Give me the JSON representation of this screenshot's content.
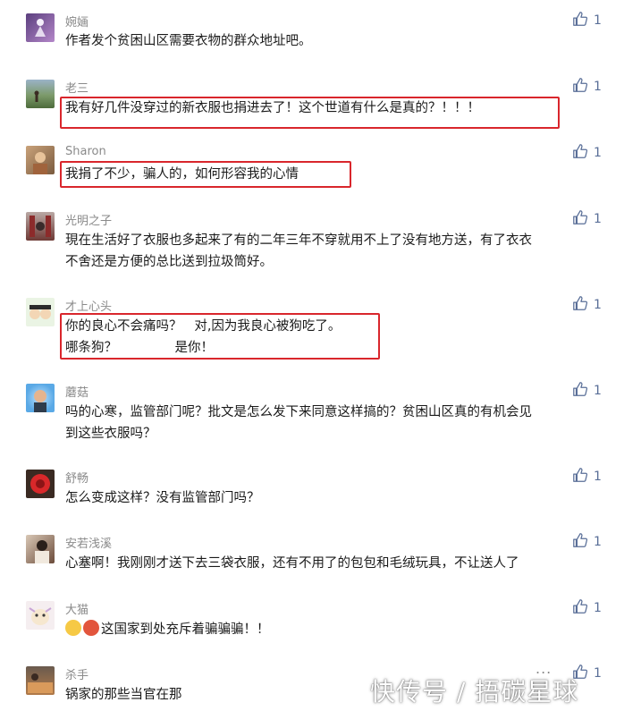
{
  "comments": [
    {
      "name": "婉婳",
      "lines": [
        "作者发个贫困山区需要衣物的群众地址吧。"
      ],
      "likes": "1"
    },
    {
      "name": "老三",
      "lines": [
        "我有好几件没穿过的新衣服也捐进去了！这个世道有什么是真的？！！！"
      ],
      "likes": "1"
    },
    {
      "name": "Sharon",
      "lines": [
        "我捐了不少，骗人的，如何形容我的心情"
      ],
      "likes": "1"
    },
    {
      "name": "光明之子",
      "lines": [
        "現在生活好了衣服也多起来了有的二年三年不穿就用不上了没有地方送，有了衣衣",
        "不舍还是方便的总比送到拉圾筒好。"
      ],
      "likes": "1"
    },
    {
      "name": "才上心头",
      "lines": [
        "你的良心不会痛吗？   对,因为我良心被狗吃了。",
        "哪条狗？              是你！"
      ],
      "likes": "1"
    },
    {
      "name": "蘑菇",
      "lines": [
        "吗的心寒，监管部门呢？批文是怎么发下来同意这样搞的？贫困山区真的有机会见",
        "到这些衣服吗？"
      ],
      "likes": "1"
    },
    {
      "name": "舒畅",
      "lines": [
        "怎么变成这样？没有监管部门吗？"
      ],
      "likes": "1"
    },
    {
      "name": "安若浅溪",
      "lines": [
        "心塞啊！我刚刚才送下去三袋衣服，还有不用了的包包和毛绒玩具，不让送人了"
      ],
      "likes": "1"
    },
    {
      "name": "大猫",
      "lines": [
        "这国家到处充斥着骗骗骗！！"
      ],
      "likes": "1"
    },
    {
      "name": "杀手",
      "lines": [
        "锅家的那些当官在那"
      ],
      "likes": "1"
    }
  ],
  "more_label": "...",
  "watermark": "快传号 / 捂碳星球",
  "colors": {
    "highlight": "#d9262c",
    "like": "#5a6f98",
    "name": "#8a8a8a"
  },
  "icons": {
    "like": "thumbs-up-icon",
    "more": "more-dots-icon"
  }
}
